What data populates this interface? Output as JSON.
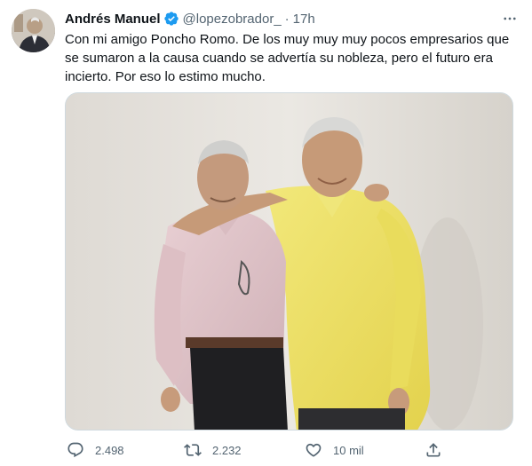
{
  "tweet": {
    "author": {
      "display_name": "Andrés Manuel",
      "handle": "@lopezobrador_",
      "verified": true
    },
    "separator": "·",
    "time": "17h",
    "text": "Con mi amigo Poncho Romo. De los muy muy muy pocos empresarios que se sumaron a la causa cuando se advertía su nobleza, pero el futuro era incierto. Por eso lo estimo mucho.",
    "media": {
      "type": "photo",
      "subject": "two men posing together"
    },
    "actions": {
      "replies": "2.498",
      "retweets": "2.232",
      "likes": "10 mil"
    }
  },
  "colors": {
    "text_primary": "#0f1419",
    "text_secondary": "#536471",
    "verified_blue": "#1d9bf0",
    "border": "#cfd9de"
  },
  "icons": [
    "more-icon",
    "verified-icon",
    "reply-icon",
    "retweet-icon",
    "like-icon",
    "share-icon"
  ]
}
